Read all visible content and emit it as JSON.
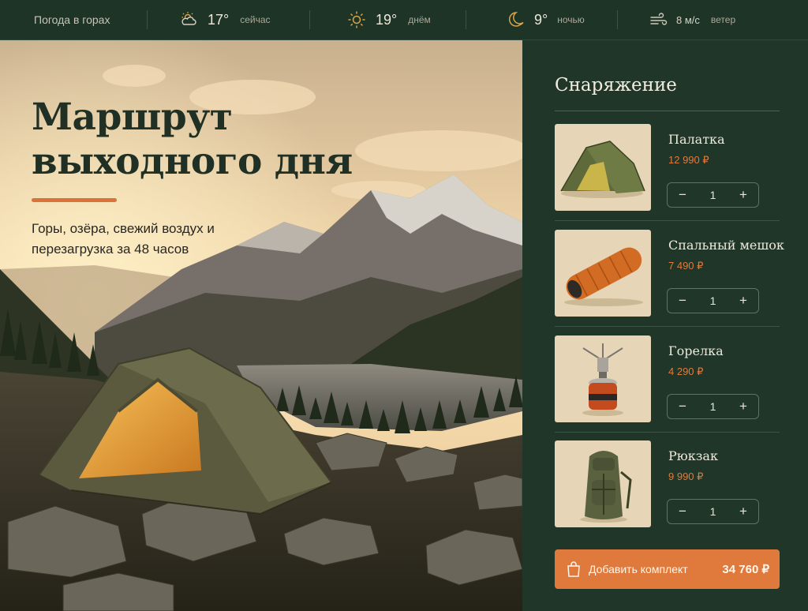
{
  "weather": {
    "title": "Погода в горах",
    "now": {
      "icon": "partly-cloudy-icon",
      "temp": "17°",
      "label": "сейчас"
    },
    "day": {
      "icon": "sun-icon",
      "temp": "19°",
      "label": "днём"
    },
    "night": {
      "icon": "moon-icon",
      "temp": "9°",
      "label": "ночью"
    },
    "wind": {
      "icon": "wind-icon",
      "value": "8 м/с",
      "label": "ветер"
    }
  },
  "hero": {
    "title": "Маршрут выходного дня",
    "subtitle": "Горы, озёра, свежий воздух и перезагрузка за 48 часов"
  },
  "gear": {
    "title": "Снаряжение",
    "items": [
      {
        "name": "Палатка",
        "price": "12 990 ₽",
        "qty": "1",
        "icon": "tent-icon"
      },
      {
        "name": "Спальный мешок",
        "price": "7 490 ₽",
        "qty": "1",
        "icon": "sleeping-bag-icon"
      },
      {
        "name": "Горелка",
        "price": "4 290 ₽",
        "qty": "1",
        "icon": "burner-icon"
      },
      {
        "name": "Рюкзак",
        "price": "9 990 ₽",
        "qty": "1",
        "icon": "backpack-icon"
      }
    ],
    "stepper": {
      "minus": "−",
      "plus": "+"
    },
    "add_label": "Добавить комплект",
    "total": "34 760 ₽"
  },
  "colors": {
    "panel_bg": "#1f3629",
    "accent": "#e07a3c",
    "title_dark": "#203024"
  }
}
